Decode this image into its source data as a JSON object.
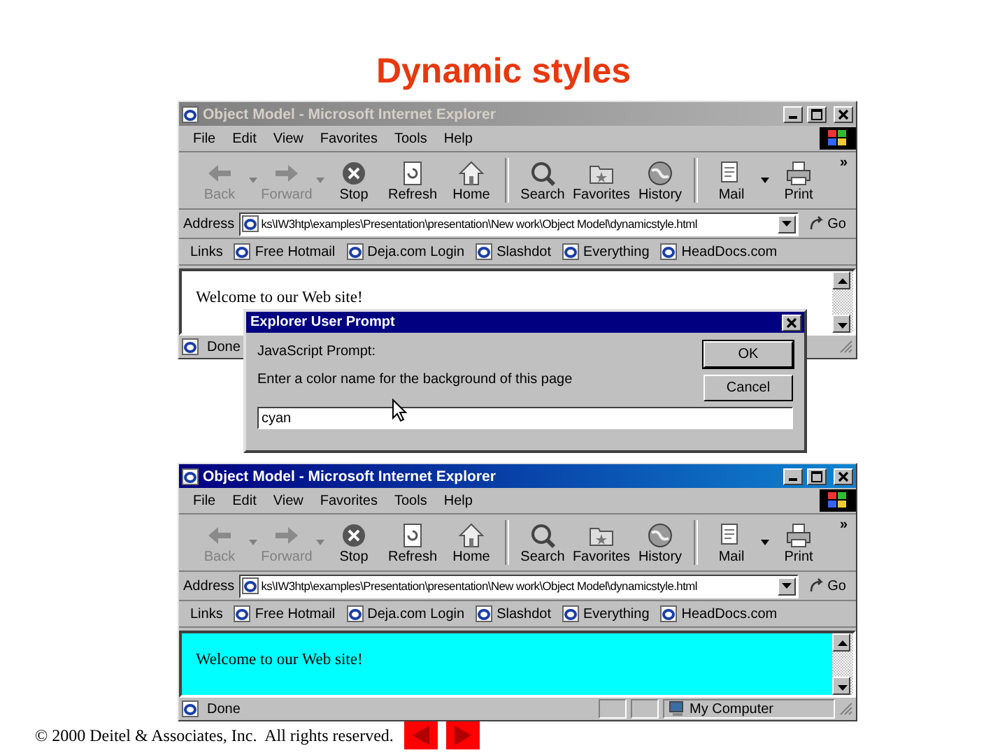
{
  "title": "Dynamic styles",
  "windows": [
    {
      "title": "Object Model - Microsoft Internet Explorer",
      "active": false,
      "menu": [
        "File",
        "Edit",
        "View",
        "Favorites",
        "Tools",
        "Help"
      ],
      "toolbar": [
        {
          "label": "Back",
          "disabled": true,
          "dropdown": true
        },
        {
          "label": "Forward",
          "disabled": true,
          "dropdown": true
        },
        {
          "label": "Stop",
          "disabled": false,
          "dropdown": false
        },
        {
          "label": "Refresh",
          "disabled": false,
          "dropdown": false
        },
        {
          "label": "Home",
          "disabled": false,
          "dropdown": false
        },
        {
          "label": "Search",
          "disabled": false,
          "dropdown": false
        },
        {
          "label": "Favorites",
          "disabled": false,
          "dropdown": false
        },
        {
          "label": "History",
          "disabled": false,
          "dropdown": false
        },
        {
          "label": "Mail",
          "disabled": false,
          "dropdown": true
        },
        {
          "label": "Print",
          "disabled": false,
          "dropdown": false
        }
      ],
      "toolbar_more": "»",
      "address_label": "Address",
      "address": "ks\\IW3htp\\examples\\Presentation\\presentation\\New work\\Object Model\\dynamicstyle.html",
      "go": "Go",
      "links_label": "Links",
      "links": [
        "Free Hotmail",
        "Deja.com Login",
        "Slashdot",
        "Everything",
        "HeadDocs.com"
      ],
      "page_text": "Welcome to our Web site!",
      "color": "#ffffff",
      "status": "Done"
    },
    {
      "title": "Object Model - Microsoft Internet Explorer",
      "active": true,
      "menu": [
        "File",
        "Edit",
        "View",
        "Favorites",
        "Tools",
        "Help"
      ],
      "toolbar": [
        {
          "label": "Back",
          "disabled": true,
          "dropdown": true
        },
        {
          "label": "Forward",
          "disabled": true,
          "dropdown": true
        },
        {
          "label": "Stop",
          "disabled": false,
          "dropdown": false
        },
        {
          "label": "Refresh",
          "disabled": false,
          "dropdown": false
        },
        {
          "label": "Home",
          "disabled": false,
          "dropdown": false
        },
        {
          "label": "Search",
          "disabled": false,
          "dropdown": false
        },
        {
          "label": "Favorites",
          "disabled": false,
          "dropdown": false
        },
        {
          "label": "History",
          "disabled": false,
          "dropdown": false
        },
        {
          "label": "Mail",
          "disabled": false,
          "dropdown": true
        },
        {
          "label": "Print",
          "disabled": false,
          "dropdown": false
        }
      ],
      "toolbar_more": "»",
      "address_label": "Address",
      "address": "ks\\IW3htp\\examples\\Presentation\\presentation\\New work\\Object Model\\dynamicstyle.html",
      "go": "Go",
      "links_label": "Links",
      "links": [
        "Free Hotmail",
        "Deja.com Login",
        "Slashdot",
        "Everything",
        "HeadDocs.com"
      ],
      "page_text": "Welcome to our Web site!",
      "color": "#00ffff",
      "status": "Done",
      "zone": "My Computer"
    }
  ],
  "dialog": {
    "title": "Explorer User Prompt",
    "caption": "JavaScript Prompt:",
    "message": "Enter a color name for the background of this page",
    "value": "cyan",
    "buttons": [
      "OK",
      "Cancel"
    ]
  },
  "footer": {
    "copyright": "© 2000 Deitel & Associates, Inc.  All rights reserved."
  }
}
